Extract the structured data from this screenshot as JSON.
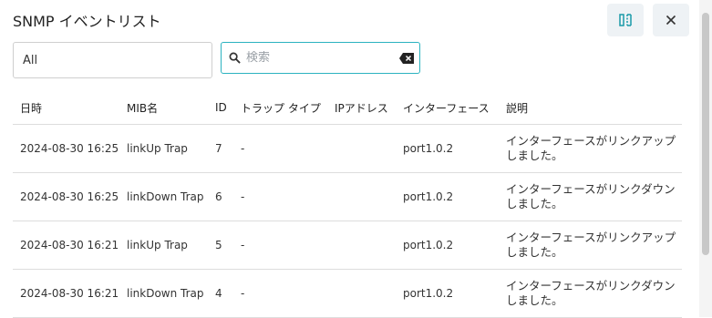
{
  "dialog": {
    "title": "SNMP イベントリスト"
  },
  "icons": {
    "columns": "columns-icon",
    "close": "close-icon",
    "search": "search-icon",
    "clear": "backspace-icon"
  },
  "colors": {
    "accent": "#2bb3c0",
    "button_bg": "#eef2f5"
  },
  "filter": {
    "selected": "All"
  },
  "search": {
    "placeholder": "検索",
    "value": ""
  },
  "table": {
    "headers": [
      "日時",
      "MIB名",
      "ID",
      "トラップ タイプ",
      "IPアドレス",
      "インターフェース",
      "説明"
    ],
    "rows": [
      [
        "2024-08-30 16:25",
        "linkUp Trap",
        "7",
        "-",
        "",
        "port1.0.2",
        "インターフェースがリンクアップしました。"
      ],
      [
        "2024-08-30 16:25",
        "linkDown Trap",
        "6",
        "-",
        "",
        "port1.0.2",
        "インターフェースがリンクダウンしました。"
      ],
      [
        "2024-08-30 16:21",
        "linkUp Trap",
        "5",
        "-",
        "",
        "port1.0.2",
        "インターフェースがリンクアップしました。"
      ],
      [
        "2024-08-30 16:21",
        "linkDown Trap",
        "4",
        "-",
        "",
        "port1.0.2",
        "インターフェースがリンクダウンしました。"
      ]
    ]
  }
}
